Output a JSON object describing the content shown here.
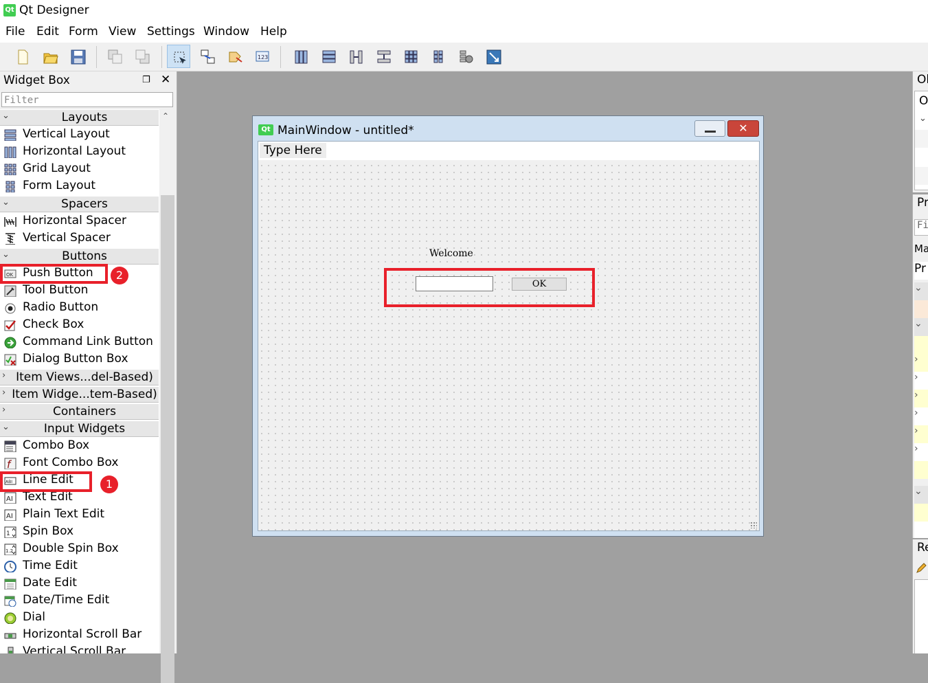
{
  "app": {
    "title": "Qt Designer",
    "icon": "qt-logo-icon"
  },
  "menu": [
    "File",
    "Edit",
    "Form",
    "View",
    "Settings",
    "Window",
    "Help"
  ],
  "toolbar": {
    "buttons": [
      "new-form-icon",
      "open-form-icon",
      "save-form-icon",
      "send-to-back-icon",
      "bring-to-front-icon",
      "edit-widgets-icon",
      "edit-signals-slots-icon",
      "edit-buddies-icon",
      "edit-tab-order-icon",
      "lay-out-horizontally-icon",
      "lay-out-vertically-icon",
      "lay-out-horizontally-splitter-icon",
      "lay-out-vertically-splitter-icon",
      "lay-out-grid-icon",
      "lay-out-form-icon",
      "break-layout-icon",
      "adjust-size-icon"
    ]
  },
  "widget_box": {
    "title": "Widget Box",
    "float_glyph": "❐",
    "close_glyph": "✕",
    "filter_placeholder": "Filter",
    "categories": [
      {
        "label": "Layouts",
        "expanded": true,
        "items": [
          "Vertical Layout",
          "Horizontal Layout",
          "Grid Layout",
          "Form Layout"
        ]
      },
      {
        "label": "Spacers",
        "expanded": true,
        "items": [
          "Horizontal Spacer",
          "Vertical Spacer"
        ]
      },
      {
        "label": "Buttons",
        "expanded": true,
        "items": [
          "Push Button",
          "Tool Button",
          "Radio Button",
          "Check Box",
          "Command Link Button",
          "Dialog Button Box"
        ]
      },
      {
        "label": "Item Views...del-Based)",
        "expanded": false,
        "items": []
      },
      {
        "label": "Item Widge...tem-Based)",
        "expanded": false,
        "items": []
      },
      {
        "label": "Containers",
        "expanded": false,
        "items": []
      },
      {
        "label": "Input Widgets",
        "expanded": true,
        "items": [
          "Combo Box",
          "Font Combo Box",
          "Line Edit",
          "Text Edit",
          "Plain Text Edit",
          "Spin Box",
          "Double Spin Box",
          "Time Edit",
          "Date Edit",
          "Date/Time Edit",
          "Dial",
          "Horizontal Scroll Bar",
          "Vertical Scroll Bar"
        ]
      }
    ]
  },
  "annotations": {
    "badge_1": "1",
    "badge_2": "2"
  },
  "main_window": {
    "title": "MainWindow - untitled*",
    "menu_placeholder": "Type Here",
    "welcome_label": "Welcome",
    "line_edit_value": "",
    "ok_button": "OK"
  },
  "right_panels": {
    "object_inspector_title": "Ol",
    "object_inspector_row": "O",
    "property_editor_title": "Pr",
    "property_filter": "Fi",
    "property_row_1": "Ma",
    "property_row_2": "Pr",
    "resource_browser_title": "Re"
  },
  "colors": {
    "annotation_red": "#e8202a",
    "qt_green": "#41cd52",
    "property_highlight": "#ffffd0",
    "property_selected": "#fbe9d8"
  }
}
